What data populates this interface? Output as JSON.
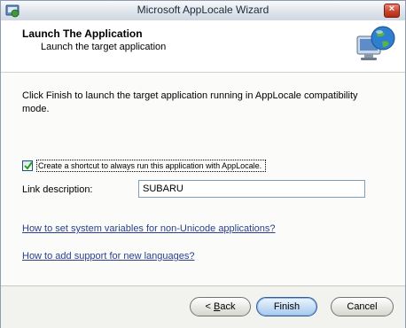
{
  "window": {
    "title": "Microsoft AppLocale Wizard",
    "close_label": "×"
  },
  "header": {
    "title": "Launch The Application",
    "subtitle": "Launch the target application"
  },
  "body": {
    "description": "Click Finish to launch the target application running in AppLocale compatibility mode.",
    "shortcut_checkbox": {
      "label": "Create a shortcut to always run this application with AppLocale.",
      "checked": true
    },
    "link_description": {
      "label": "Link description:",
      "value": "SUBARU"
    },
    "links": [
      "How to set system variables for non-Unicode applications?",
      "How to add support for new languages?"
    ]
  },
  "footer": {
    "back_mnemonic": "B",
    "back_rest": "ack",
    "back_prefix": "< ",
    "finish_label": "Finish",
    "cancel_label": "Cancel"
  },
  "colors": {
    "link": "#2a3f8f",
    "finish_button": "#a6c8ee",
    "close_button": "#c9452d"
  }
}
